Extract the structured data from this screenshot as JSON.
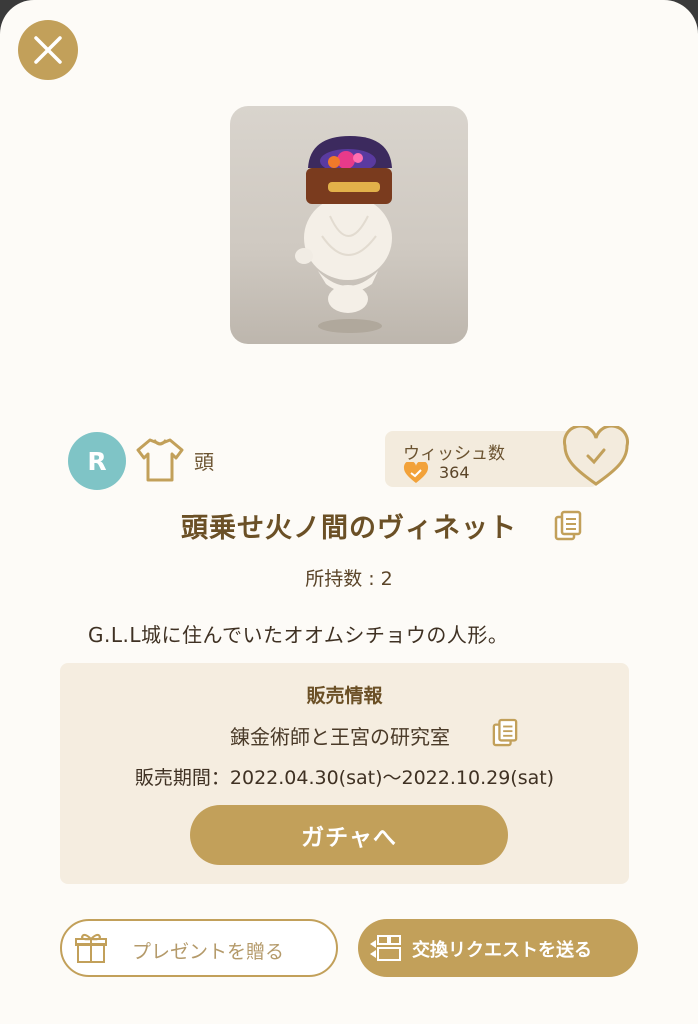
{
  "item": {
    "title": "頭乗せ火ノ間のヴィネット",
    "rarity": "R",
    "category": "頭",
    "owned": "所持数 : 2",
    "description": "G.L.L城に住んでいたオオムシチョウの人形。"
  },
  "wish": {
    "label": "ウィッシュ数",
    "count": "364"
  },
  "sale": {
    "heading": "販売情報",
    "name": "錬金術師と王宮の研究室",
    "period": "販売期間：2022.04.30(sat)〜2022.10.29(sat)",
    "gacha_button": "ガチャへ"
  },
  "actions": {
    "present": "プレゼントを贈る",
    "exchange": "交換リクエストを送る"
  },
  "colors": {
    "accent": "#c2a05a",
    "rarity_badge": "#7fc4c6",
    "wish_heart": "#f2a23a",
    "background": "#fdfbf7"
  },
  "icons": {
    "close": "close-icon",
    "category": "shirt-icon",
    "wish_small": "heart-icon",
    "wish_button": "heart-check-icon",
    "copy": "copy-icon",
    "present": "gift-icon",
    "exchange": "exchange-icon"
  }
}
